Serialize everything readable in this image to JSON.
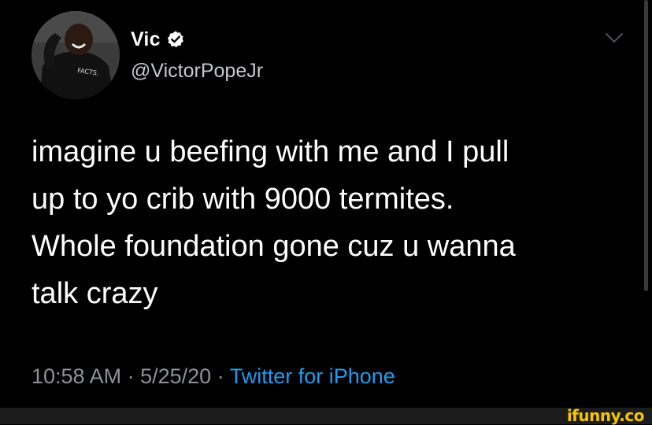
{
  "tweet": {
    "author": {
      "display_name": "Vic",
      "handle": "@VictorPopeJr",
      "verified": true,
      "avatar_shirt_text": "FACTS."
    },
    "body_lines": [
      "imagine u beefing with me and I pull",
      "up to yo crib with 9000 termites.",
      "Whole foundation gone cuz u wanna",
      "talk crazy"
    ],
    "meta": {
      "time": "10:58 AM",
      "separator": "·",
      "date": "5/25/20",
      "source": "Twitter for iPhone"
    },
    "icons": {
      "verified": "verified-badge-icon",
      "menu": "chevron-down-icon"
    }
  },
  "watermark": {
    "text": "ifunny.co"
  },
  "colors": {
    "background": "#000000",
    "handle": "#c4c8cc",
    "meta": "#8b939a",
    "source": "#1d9bf0",
    "verified": "#ffffff",
    "watermark": "#f5c400"
  }
}
